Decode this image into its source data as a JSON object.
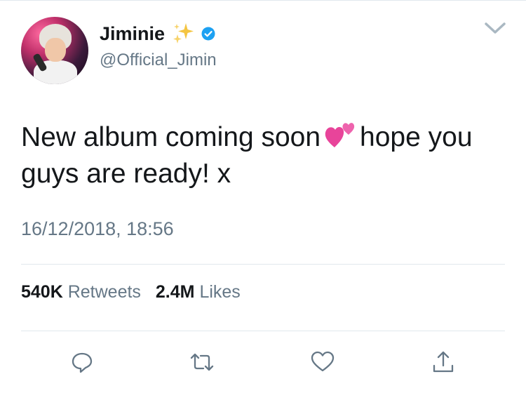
{
  "tweet": {
    "author": {
      "display_name": "Jiminie",
      "handle": "@Official_Jimin",
      "name_emoji": "sparkles-icon",
      "verified": true
    },
    "text_before_emoji": "New album coming soon",
    "emoji": "two-hearts-icon",
    "text_after_emoji": "hope you guys are ready! x",
    "timestamp": "16/12/2018, 18:56",
    "stats": {
      "retweets_count": "540K",
      "retweets_label": "Retweets",
      "likes_count": "2.4M",
      "likes_label": "Likes"
    },
    "actions": [
      "reply-icon",
      "retweet-icon",
      "like-icon",
      "share-icon"
    ]
  },
  "colors": {
    "text_primary": "#14171a",
    "text_secondary": "#657786",
    "divider": "#e1e8ed",
    "verified_blue": "#1da1f2",
    "sparkle_gold": "#f4c542",
    "heart_pink": "#e8449a"
  }
}
